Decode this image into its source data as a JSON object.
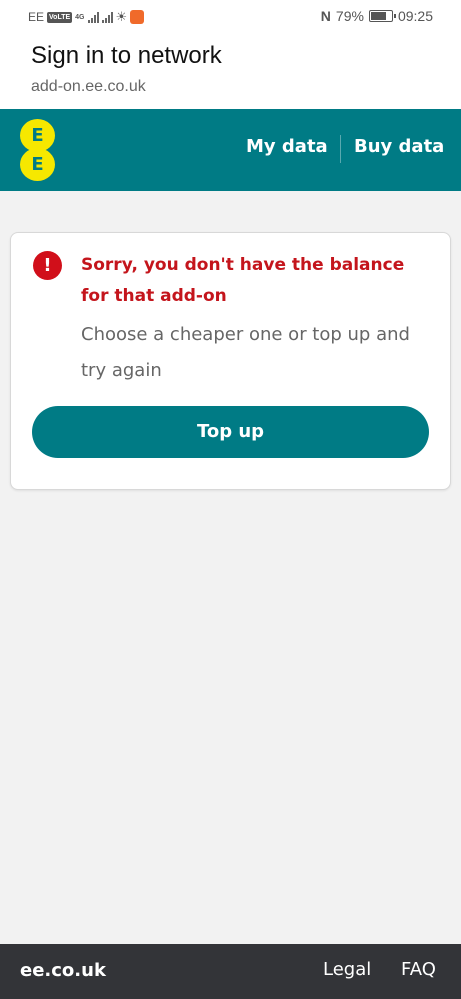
{
  "status_bar": {
    "carrier": "EE",
    "volte": "VoLTE",
    "network_type": "4G",
    "battery_percent_text": "79%",
    "battery_level": 0.79,
    "time": "09:25"
  },
  "portal": {
    "title": "Sign in to network",
    "url": "add-on.ee.co.uk"
  },
  "nav": {
    "logo_letters": [
      "E",
      "E"
    ],
    "my_data": "My data",
    "buy_data": "Buy data",
    "brand_color": "#007b85",
    "logo_color": "#f6e800"
  },
  "error_card": {
    "icon": "!",
    "title": "Sorry, you don't have the balance for that add-on",
    "message": "Choose a cheaper one or top up and try again",
    "button_label": "Top up",
    "error_color": "#c4151c"
  },
  "footer": {
    "site": "ee.co.uk",
    "legal": "Legal",
    "faq": "FAQ"
  }
}
